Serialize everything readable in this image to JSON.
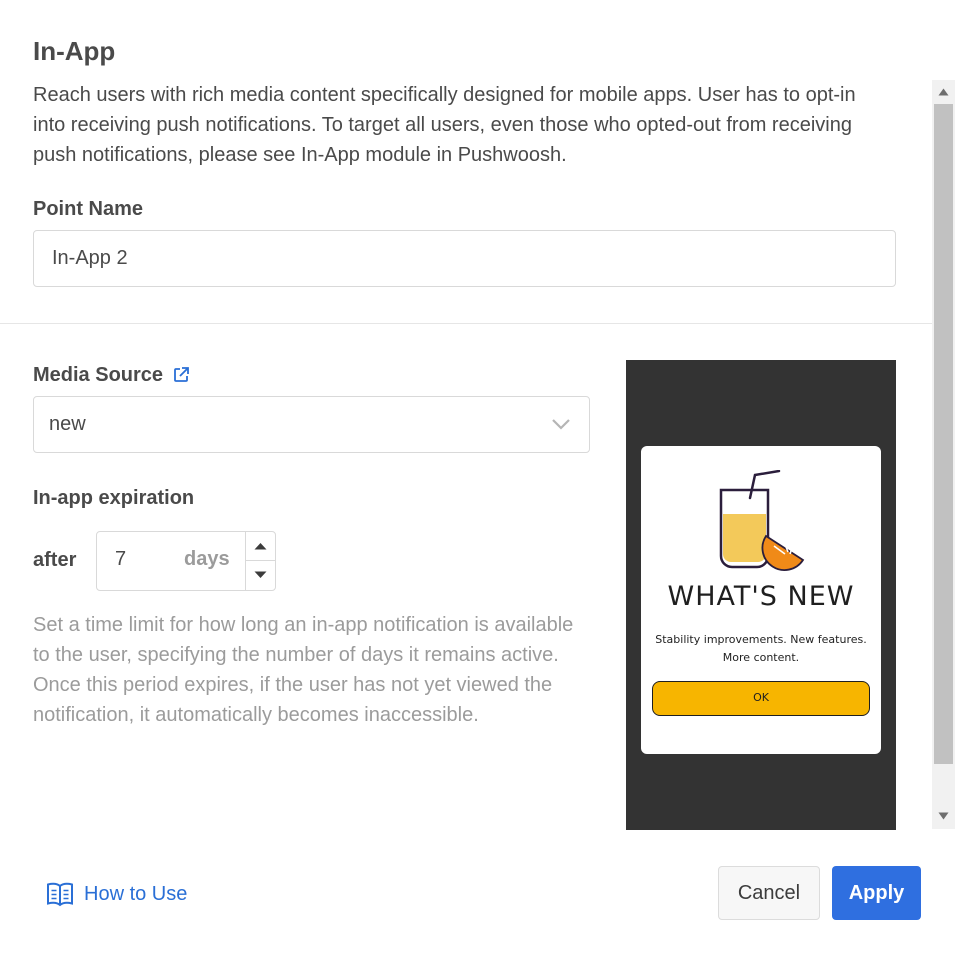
{
  "header": {
    "title": "In-App",
    "description": "Reach users with rich media content specifically designed for mobile apps. User has to opt-in into receiving push notifications. To target all users, even those who opted-out from receiving push notifications, please see In-App module in Pushwoosh."
  },
  "point_name": {
    "label": "Point Name",
    "value": "In-App 2"
  },
  "media_source": {
    "label": "Media Source",
    "selected": "new",
    "link_icon": "external-link-icon"
  },
  "expiration": {
    "label": "In-app expiration",
    "prefix": "after",
    "value": "7",
    "unit": "days",
    "help": "Set a time limit for how long an in-app notification is available to the user, specifying the number of days it remains active. Once this period expires, if the user has not yet viewed the notification, it automatically becomes inaccessible."
  },
  "preview": {
    "title": "WHAT'S NEW",
    "text": "Stability improvements. New features. More content.",
    "button": "OK",
    "illustration": "juice-glass-with-orange"
  },
  "footer": {
    "how_to_use": "How to Use",
    "cancel": "Cancel",
    "apply": "Apply"
  },
  "colors": {
    "primary": "#2f6fe0",
    "link": "#2a6fd6",
    "preview_bg": "#333333",
    "preview_button": "#f7b500"
  }
}
